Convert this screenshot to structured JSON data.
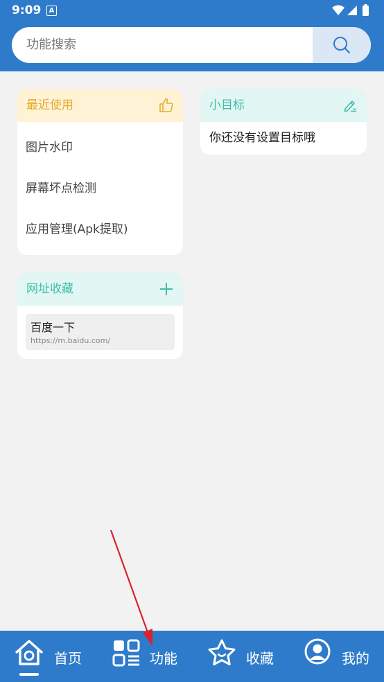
{
  "status_bar": {
    "time": "9:09",
    "notification_badge": "A"
  },
  "search": {
    "placeholder": "功能搜索",
    "icon": "search-icon"
  },
  "recent_card": {
    "title": "最近使用",
    "icon": "thumbs-up-icon",
    "items": [
      "图片水印",
      "屏幕坏点检测",
      "应用管理(Apk提取)"
    ]
  },
  "goal_card": {
    "title": "小目标",
    "icon": "edit-icon",
    "empty_text": "你还没有设置目标哦"
  },
  "bookmarks_card": {
    "title": "网址收藏",
    "icon": "plus-icon",
    "items": [
      {
        "title": "百度一下",
        "url": "https://m.baidu.com/"
      }
    ]
  },
  "bottom_nav": {
    "items": [
      {
        "label": "首页",
        "icon": "home-icon"
      },
      {
        "label": "功能",
        "icon": "grid-icon"
      },
      {
        "label": "收藏",
        "icon": "star-icon"
      },
      {
        "label": "我的",
        "icon": "user-icon"
      }
    ]
  },
  "colors": {
    "primary": "#2f7bcb",
    "recent_accent": "#e7ab2e",
    "teal_accent": "#3bbfa7",
    "annotation_arrow": "#d8232a"
  }
}
